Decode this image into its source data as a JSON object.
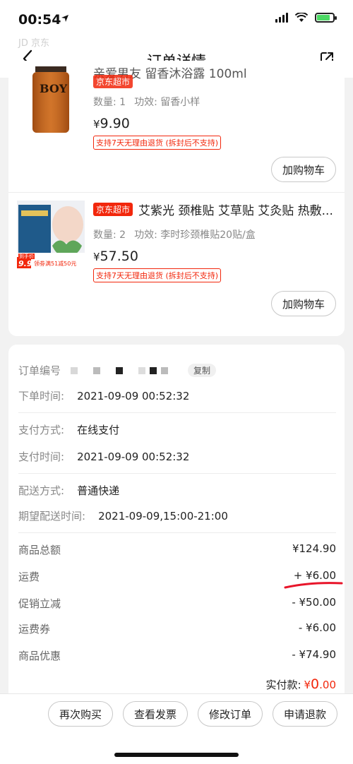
{
  "status_bar": {
    "time": "00:54"
  },
  "nav": {
    "watermark": "JD 京东",
    "title": "订单详情"
  },
  "products": [
    {
      "title_prefix": "亲爱男友 留香沐浴露 100ml",
      "quantity": "数量: 1",
      "effect": "功效: 留香小样",
      "price_symbol": "¥",
      "price": "9.90",
      "return_policy": "支持7天无理由退货 (拆封后不支持)",
      "cart_button": "加购物车",
      "image_text": "BOY"
    },
    {
      "tag": "京东超市",
      "title": "艾紫光 颈椎贴 艾草贴 艾灸贴 热敷...",
      "quantity": "数量: 2",
      "effect": "功效: 李时珍颈椎贴20贴/盒",
      "price_symbol": "¥",
      "price": "57.50",
      "return_policy": "支持7天无理由退货 (拆封后不支持)",
      "cart_button": "加购物车",
      "image_badge": "到手价",
      "image_price": "9.9",
      "image_promo": "领劵满51减50元"
    }
  ],
  "order_info": {
    "order_no_label": "订单编号",
    "copy_label": "复制",
    "order_time_label": "下单时间:",
    "order_time": "2021-09-09 00:52:32",
    "payment_method_label": "支付方式:",
    "payment_method": "在线支付",
    "payment_time_label": "支付时间:",
    "payment_time": "2021-09-09 00:52:32",
    "delivery_method_label": "配送方式:",
    "delivery_method": "普通快递",
    "expected_delivery_label": "期望配送时间:",
    "expected_delivery": "2021-09-09,15:00-21:00"
  },
  "amounts": [
    {
      "label": "商品总额",
      "value": "¥124.90"
    },
    {
      "label": "运费",
      "value": "+ ¥6.00"
    },
    {
      "label": "促销立减",
      "value": "- ¥50.00"
    },
    {
      "label": "运费券",
      "value": "- ¥6.00"
    },
    {
      "label": "商品优惠",
      "value": "- ¥74.90"
    }
  ],
  "final": {
    "label": "实付款:",
    "symbol": "¥",
    "value": "0",
    "decimals": ".00"
  },
  "bottom_actions": [
    "再次购买",
    "查看发票",
    "修改订单",
    "申请退款"
  ],
  "colors": {
    "accent": "#f2270c",
    "annotation": "#e8152a"
  }
}
